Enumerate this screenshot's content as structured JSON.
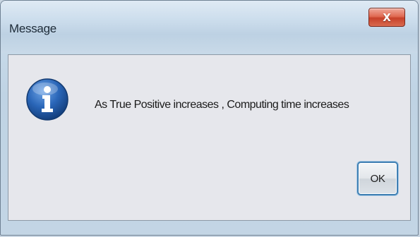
{
  "dialog": {
    "title": "Message",
    "close_label": "X",
    "message": "As True Positive increases , Computing time increases",
    "ok_label": "OK",
    "icon": "info-icon"
  },
  "colors": {
    "icon_blue": "#2a66b8",
    "close_red": "#d9533b",
    "client_bg": "#e6e7ec",
    "ok_border": "#3f7fb3"
  }
}
